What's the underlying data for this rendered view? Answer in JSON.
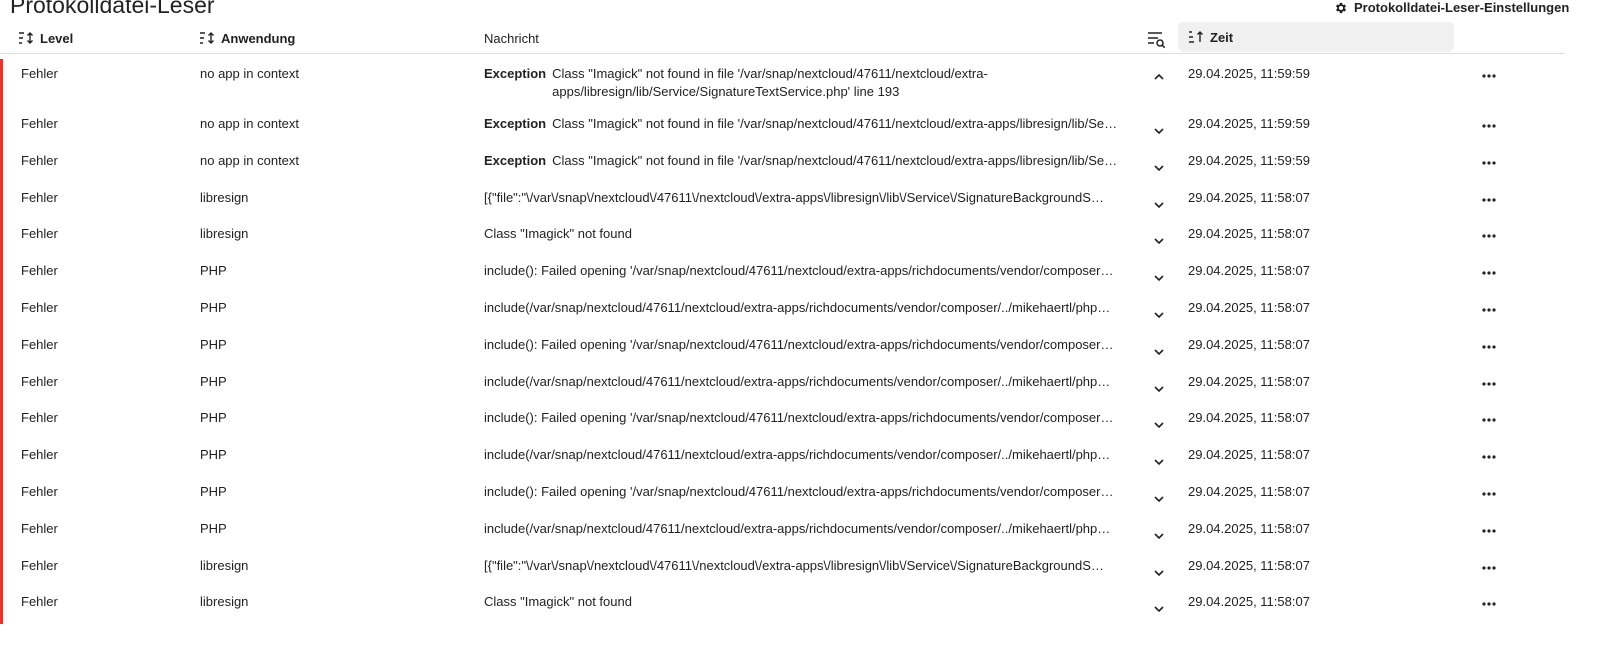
{
  "page": {
    "title": "Protokolldatei-Leser",
    "settings_label": "Protokolldatei-Leser-Einstellungen"
  },
  "columns": {
    "level": "Level",
    "app": "Anwendung",
    "message": "Nachricht",
    "time": "Zeit"
  },
  "icons": {
    "settings": "gear-icon",
    "sort": "sort-icon",
    "filter": "filter-search-icon",
    "expand": "chevron-down-icon",
    "collapse": "chevron-up-icon",
    "more": "more-horizontal-icon"
  },
  "colors": {
    "error_marker": "#e9322d",
    "header_active_bg": "#f0f0f0"
  },
  "rows": [
    {
      "level": "Fehler",
      "app": "no app in context",
      "exception": "Exception",
      "message": "Class \"Imagick\" not found in file '/var/snap/nextcloud/47611/nextcloud/extra-apps/libresign/lib/Service/SignatureTextService.php' line 193",
      "time": "29.04.2025, 11:59:59",
      "expanded": true
    },
    {
      "level": "Fehler",
      "app": "no app in context",
      "exception": "Exception",
      "message": "Class \"Imagick\" not found in file '/var/snap/nextcloud/47611/nextcloud/extra-apps/libresign/lib/Se…",
      "time": "29.04.2025, 11:59:59"
    },
    {
      "level": "Fehler",
      "app": "no app in context",
      "exception": "Exception",
      "message": "Class \"Imagick\" not found in file '/var/snap/nextcloud/47611/nextcloud/extra-apps/libresign/lib/Se…",
      "time": "29.04.2025, 11:59:59"
    },
    {
      "level": "Fehler",
      "app": "libresign",
      "exception": "",
      "message": "[{\"file\":\"\\/var\\/snap\\/nextcloud\\/47611\\/nextcloud\\/extra-apps\\/libresign\\/lib\\/Service\\/SignatureBackgroundS…",
      "time": "29.04.2025, 11:58:07"
    },
    {
      "level": "Fehler",
      "app": "libresign",
      "exception": "",
      "message": "Class \"Imagick\" not found",
      "time": "29.04.2025, 11:58:07"
    },
    {
      "level": "Fehler",
      "app": "PHP",
      "exception": "",
      "message": "include(): Failed opening '/var/snap/nextcloud/47611/nextcloud/extra-apps/richdocuments/vendor/composer…",
      "time": "29.04.2025, 11:58:07"
    },
    {
      "level": "Fehler",
      "app": "PHP",
      "exception": "",
      "message": "include(/var/snap/nextcloud/47611/nextcloud/extra-apps/richdocuments/vendor/composer/../mikehaertl/php…",
      "time": "29.04.2025, 11:58:07"
    },
    {
      "level": "Fehler",
      "app": "PHP",
      "exception": "",
      "message": "include(): Failed opening '/var/snap/nextcloud/47611/nextcloud/extra-apps/richdocuments/vendor/composer…",
      "time": "29.04.2025, 11:58:07"
    },
    {
      "level": "Fehler",
      "app": "PHP",
      "exception": "",
      "message": "include(/var/snap/nextcloud/47611/nextcloud/extra-apps/richdocuments/vendor/composer/../mikehaertl/php…",
      "time": "29.04.2025, 11:58:07"
    },
    {
      "level": "Fehler",
      "app": "PHP",
      "exception": "",
      "message": "include(): Failed opening '/var/snap/nextcloud/47611/nextcloud/extra-apps/richdocuments/vendor/composer…",
      "time": "29.04.2025, 11:58:07"
    },
    {
      "level": "Fehler",
      "app": "PHP",
      "exception": "",
      "message": "include(/var/snap/nextcloud/47611/nextcloud/extra-apps/richdocuments/vendor/composer/../mikehaertl/php…",
      "time": "29.04.2025, 11:58:07"
    },
    {
      "level": "Fehler",
      "app": "PHP",
      "exception": "",
      "message": "include(): Failed opening '/var/snap/nextcloud/47611/nextcloud/extra-apps/richdocuments/vendor/composer…",
      "time": "29.04.2025, 11:58:07"
    },
    {
      "level": "Fehler",
      "app": "PHP",
      "exception": "",
      "message": "include(/var/snap/nextcloud/47611/nextcloud/extra-apps/richdocuments/vendor/composer/../mikehaertl/php…",
      "time": "29.04.2025, 11:58:07"
    },
    {
      "level": "Fehler",
      "app": "libresign",
      "exception": "",
      "message": "[{\"file\":\"\\/var\\/snap\\/nextcloud\\/47611\\/nextcloud\\/extra-apps\\/libresign\\/lib\\/Service\\/SignatureBackgroundS…",
      "time": "29.04.2025, 11:58:07"
    },
    {
      "level": "Fehler",
      "app": "libresign",
      "exception": "",
      "message": "Class \"Imagick\" not found",
      "time": "29.04.2025, 11:58:07"
    }
  ]
}
